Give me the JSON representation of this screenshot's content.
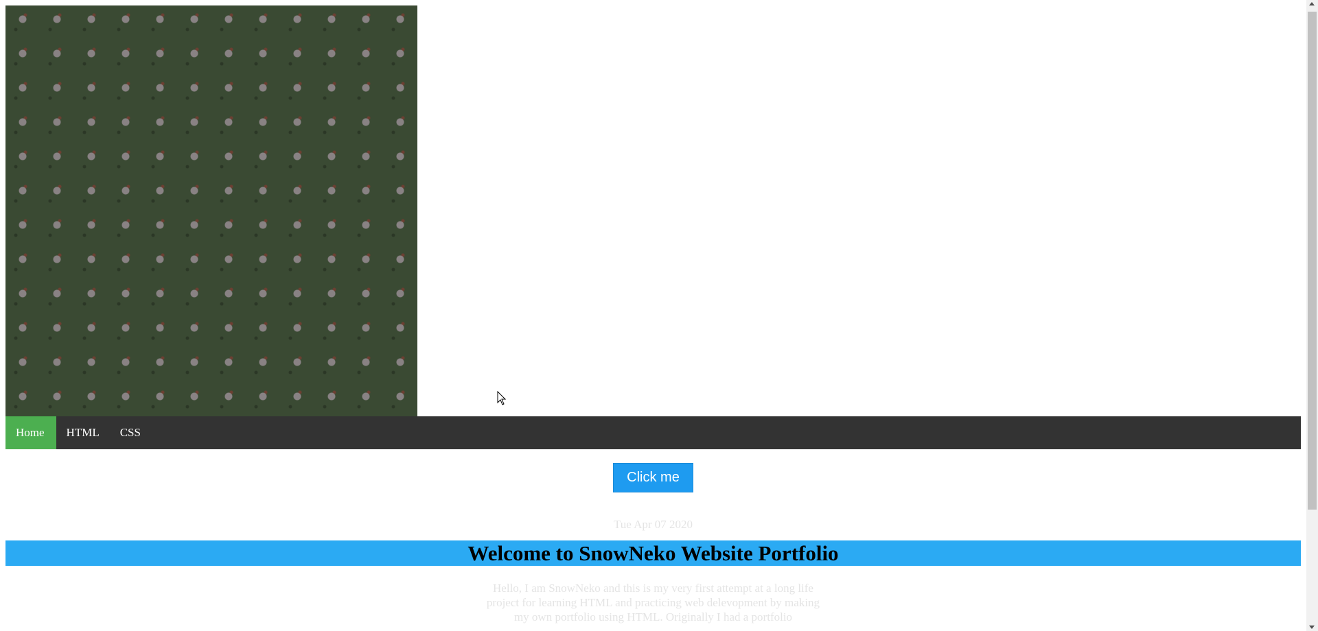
{
  "navbar": {
    "items": [
      {
        "label": "Home",
        "active": true
      },
      {
        "label": "HTML",
        "active": false
      },
      {
        "label": "CSS",
        "active": false
      }
    ],
    "background": "#333333",
    "active_color": "#4caf50"
  },
  "banner": {
    "icon": "chicken-pattern-icon",
    "background": "#3a4a33"
  },
  "button": {
    "label": "Click me",
    "color": "#1e9bf0"
  },
  "date_text": "Tue Apr 07 2020",
  "welcome": {
    "title": "Welcome to SnowNeko Website Portfolio",
    "background": "#2baaf3"
  },
  "intro_text": "Hello, I am SnowNeko and this is my very first attempt at a long life project for learning HTML and practicing web delevopment by making my own portfolio using HTML. Originally I had a portfolio"
}
